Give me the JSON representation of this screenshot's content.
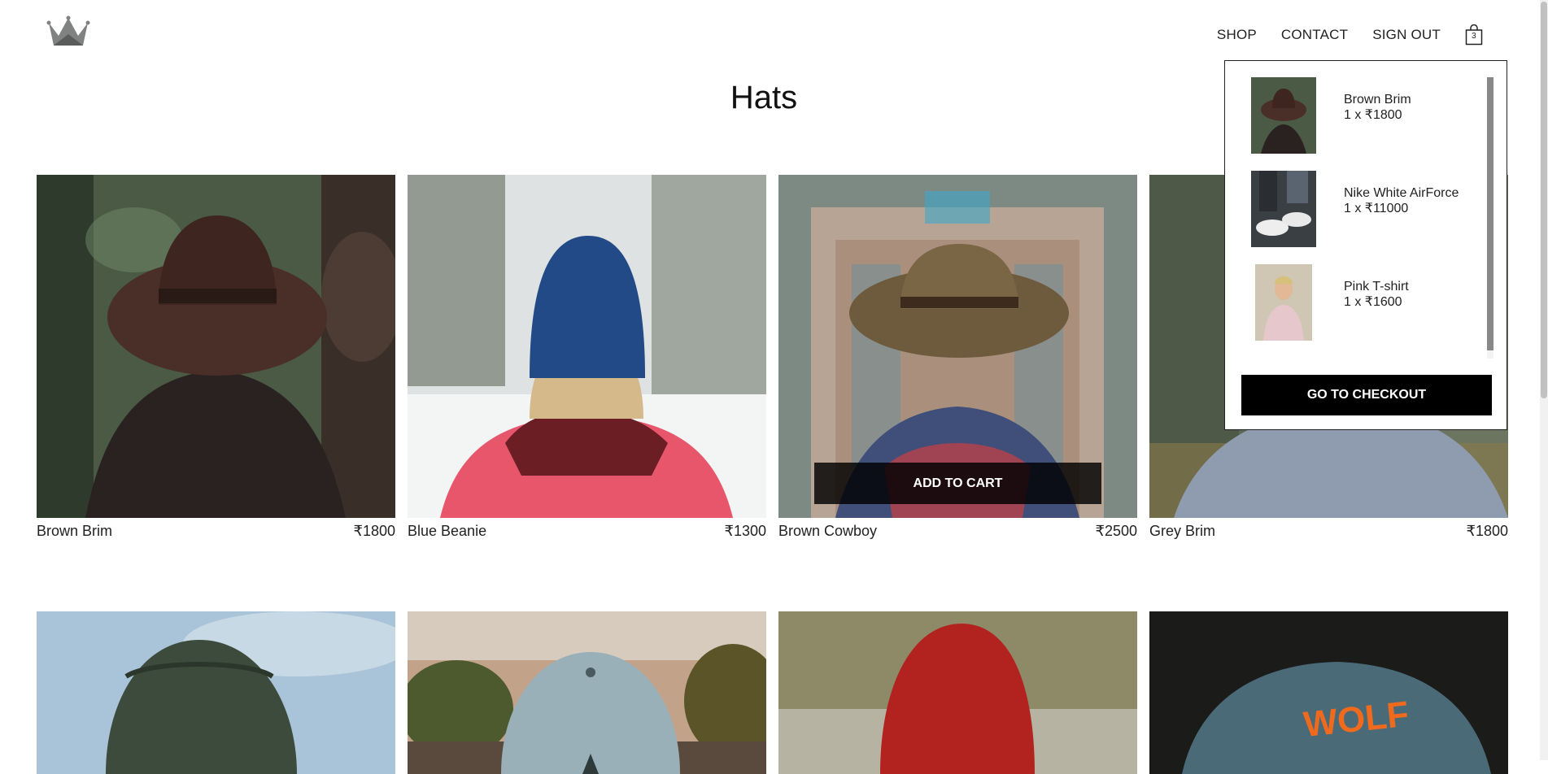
{
  "header": {
    "nav": [
      {
        "label": "SHOP"
      },
      {
        "label": "CONTACT"
      },
      {
        "label": "SIGN OUT"
      }
    ],
    "cart_count": "3"
  },
  "page": {
    "title": "Hats"
  },
  "products": [
    {
      "name": "Brown Brim",
      "price": "₹1800",
      "image": "brown-brim-photo"
    },
    {
      "name": "Blue Beanie",
      "price": "₹1300",
      "image": "blue-beanie-photo"
    },
    {
      "name": "Brown Cowboy",
      "price": "₹2500",
      "image": "brown-cowboy-photo",
      "hover_button": "ADD TO CART"
    },
    {
      "name": "Grey Brim",
      "price": "₹1800",
      "image": "grey-brim-photo"
    },
    {
      "name": "",
      "price": "",
      "image": "green-beanie-photo"
    },
    {
      "name": "",
      "price": "",
      "image": "palm-tree-cap-photo"
    },
    {
      "name": "",
      "price": "",
      "image": "red-beanie-photo"
    },
    {
      "name": "",
      "price": "",
      "image": "wolf-cap-photo"
    }
  ],
  "cart_dropdown": {
    "items": [
      {
        "name": "Brown Brim",
        "qty_price": "1 x ₹1800"
      },
      {
        "name": "Nike White AirForce",
        "qty_price": "1 x ₹11000"
      },
      {
        "name": "Pink T-shirt",
        "qty_price": "1 x ₹1600"
      }
    ],
    "checkout_label": "GO TO CHECKOUT"
  },
  "colors": {
    "text": "#222222",
    "button_bg": "#000000",
    "button_text": "#ffffff"
  }
}
